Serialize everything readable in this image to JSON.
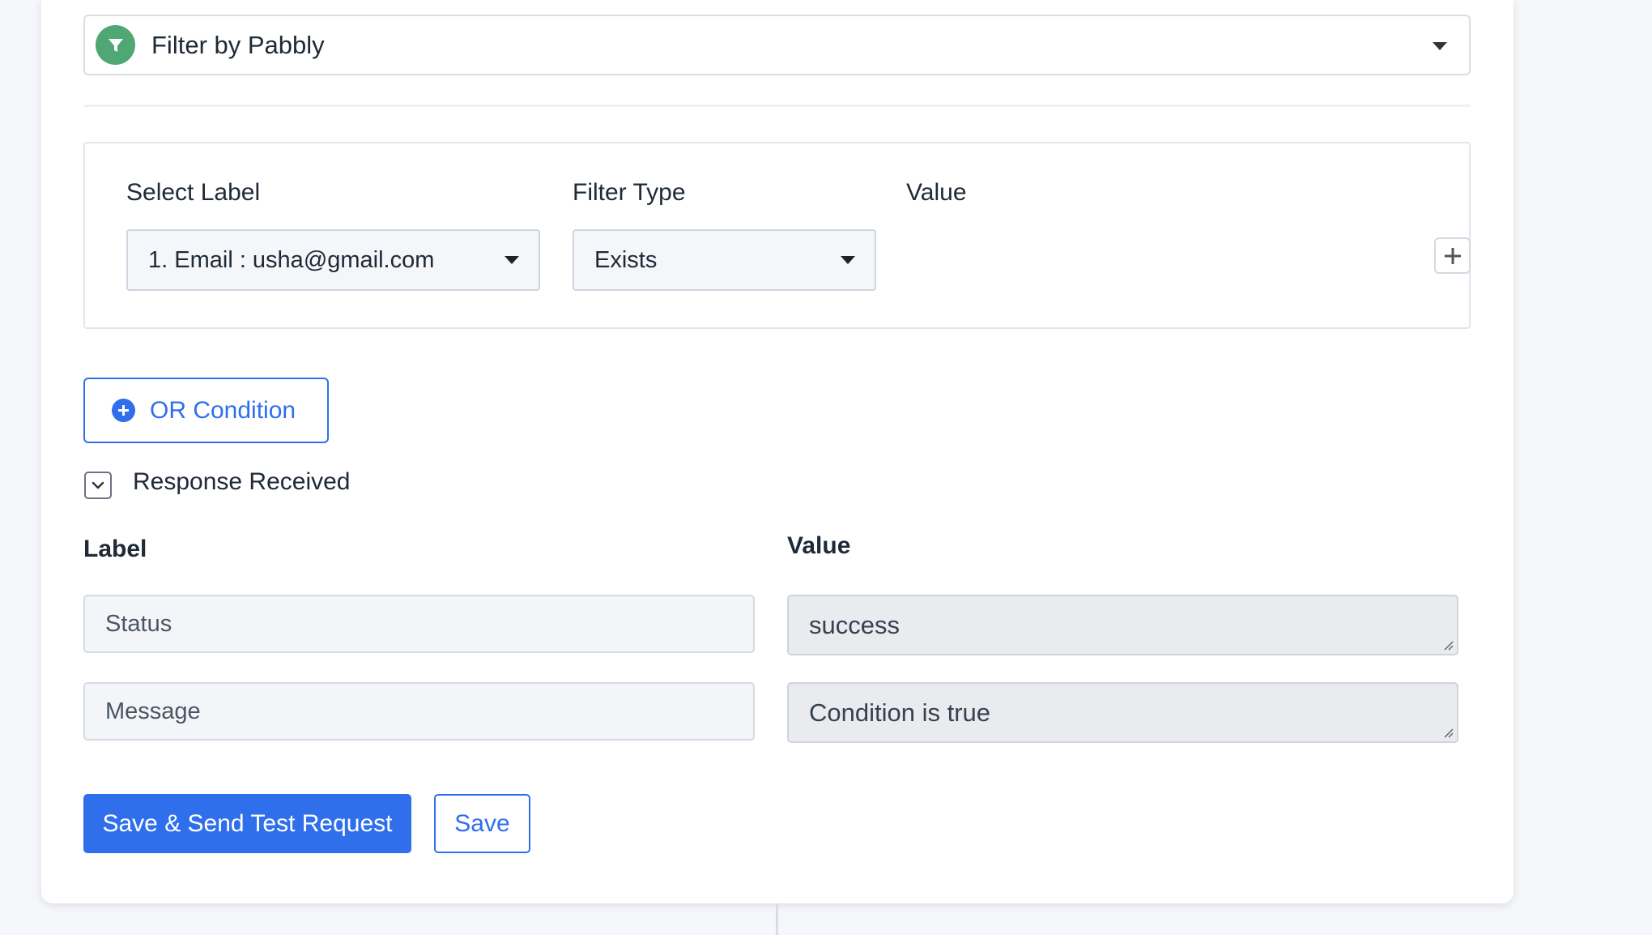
{
  "app": {
    "name": "Filter by Pabbly",
    "icon": "filter-icon"
  },
  "filter": {
    "select_label_heading": "Select Label",
    "filter_type_heading": "Filter Type",
    "value_heading": "Value",
    "selected_label": "1. Email : usha@gmail.com",
    "selected_filter_type": "Exists",
    "add_icon": "plus-icon"
  },
  "or_condition": {
    "label": "OR Condition",
    "icon": "plus-circle-icon"
  },
  "response": {
    "title": "Response Received",
    "toggle_icon": "chevron-down-icon",
    "label_heading": "Label",
    "value_heading": "Value",
    "rows": [
      {
        "label": "Status",
        "value": "success"
      },
      {
        "label": "Message",
        "value": "Condition is true"
      }
    ]
  },
  "actions": {
    "save_send_label": "Save & Send Test Request",
    "save_label": "Save"
  },
  "colors": {
    "primary": "#2f6fec",
    "app_icon_bg": "#4fa874"
  }
}
